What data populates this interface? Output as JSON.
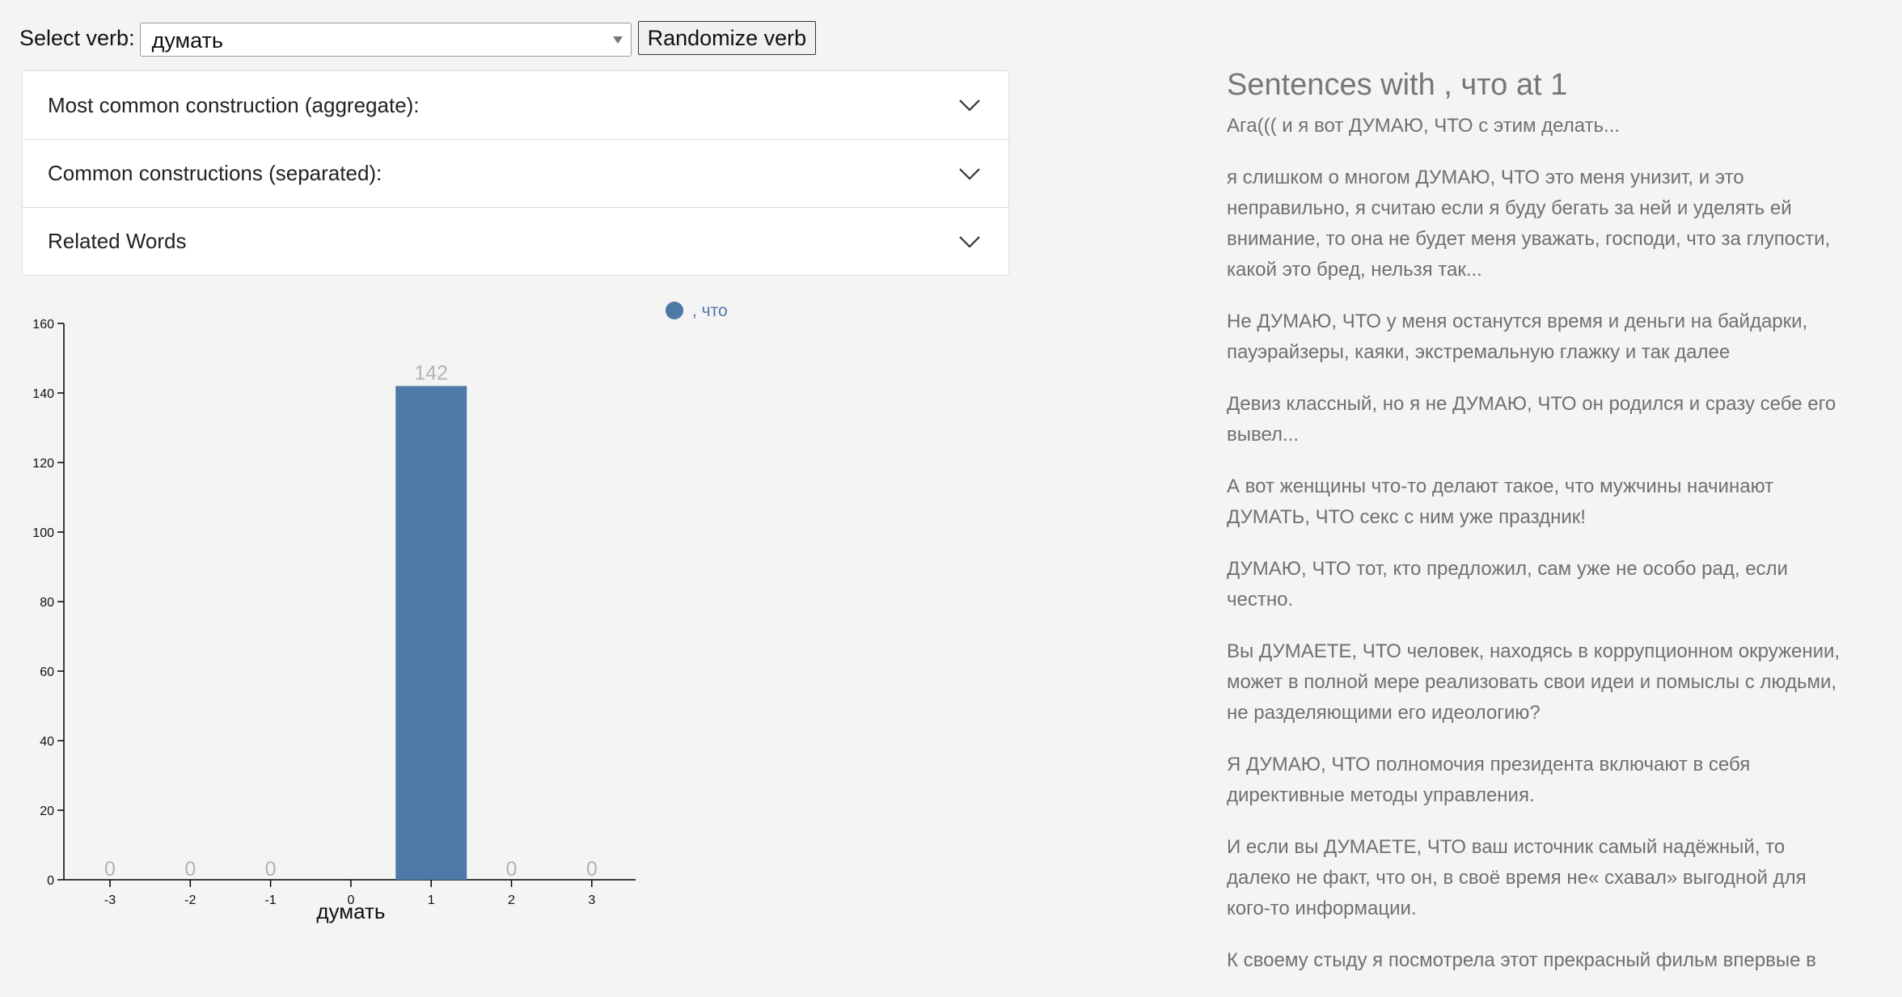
{
  "controls": {
    "select_label": "Select verb:",
    "selected_verb": "думать",
    "randomize_label": "Randomize verb"
  },
  "accordion": {
    "items": [
      {
        "label": "Most common construction (aggregate):"
      },
      {
        "label": "Common constructions (separated):"
      },
      {
        "label": "Related Words"
      }
    ]
  },
  "chart_data": {
    "type": "bar",
    "title": "",
    "xlabel": "думать",
    "ylabel": "",
    "categories": [
      "-3",
      "-2",
      "-1",
      "0",
      "1",
      "2",
      "3"
    ],
    "series": [
      {
        "name": ", что",
        "values": [
          0,
          0,
          0,
          null,
          142,
          0,
          0
        ]
      }
    ],
    "data_labels": [
      "0",
      "0",
      "0",
      "",
      "142",
      "0",
      "0"
    ],
    "ylim": [
      0,
      160
    ],
    "yticks": [
      0,
      20,
      40,
      60,
      80,
      100,
      120,
      140,
      160
    ],
    "legend_position": "top-center",
    "grid": false,
    "colors": {
      "bar": "#4e79a7",
      "data_label": "#b3b3b3"
    }
  },
  "sentences": {
    "title": "Sentences with , что at 1",
    "items": [
      "Ага((( и я вот ДУМАЮ, ЧТО с этим делать...",
      "я слишком о многом ДУМАЮ, ЧТО это меня унизит, и это неправильно, я считаю если я буду бегать за ней и уделять ей внимание, то она не будет меня уважать, господи, что за глупости, какой это бред, нельзя так...",
      "Не ДУМАЮ, ЧТО у меня останутся время и деньги на байдарки, пауэрайзеры, каяки, экстремальную глажку и так далее",
      "Девиз классный, но я не ДУМАЮ, ЧТО он родился и сразу себе его вывел...",
      "А вот женщины что-то делают такое, что мужчины начинают ДУМАТЬ, ЧТО секс с ним уже праздник!",
      "ДУМАЮ, ЧТО тот, кто предложил, сам уже не особо рад, если честно.",
      "Вы ДУМАЕТЕ, ЧТО человек, находясь в коррупционном окружении, может в полной мере реализовать свои идеи и помыслы с людьми, не разделяющими его идеологию?",
      "Я ДУМАЮ, ЧТО полномочия президента включают в себя директивные методы управления.",
      "И если вы ДУМАЕТЕ, ЧТО ваш источник самый надёжный, то далеко не факт, что он, в своё время не« схавал» выгодной для кого-то информации.",
      "К своему стыду я посмотрела этот прекрасный фильм впервые в"
    ]
  }
}
